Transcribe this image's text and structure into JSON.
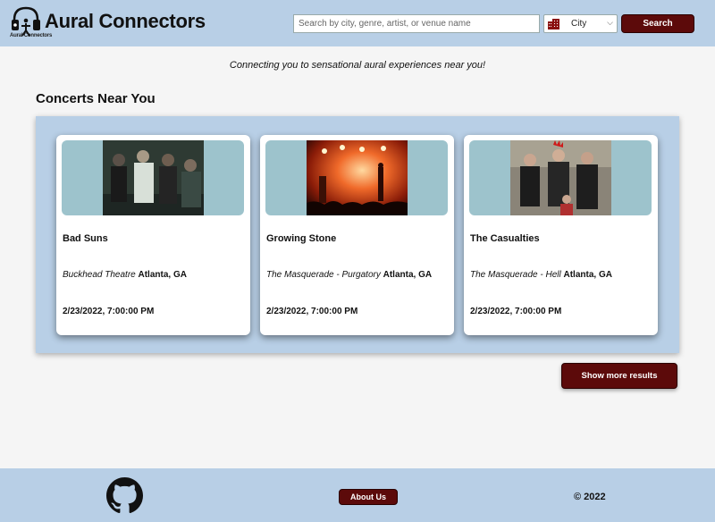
{
  "header": {
    "brand": "Aural Connectors",
    "logo_sub": "Aural Connectors",
    "search_placeholder": "Search by city, genre, artist, or venue name",
    "city_label": "City",
    "search_button": "Search"
  },
  "tagline": "Connecting you to sensational aural experiences near you!",
  "section_title": "Concerts Near You",
  "concerts": [
    {
      "title": "Bad Suns",
      "venue": "Buckhead Theatre",
      "city": "Atlanta, GA",
      "date": "2/23/2022, 7:00:00 PM"
    },
    {
      "title": "Growing Stone",
      "venue": "The Masquerade - Purgatory",
      "city": "Atlanta, GA",
      "date": "2/23/2022, 7:00:00 PM"
    },
    {
      "title": "The Casualties",
      "venue": "The Masquerade - Hell",
      "city": "Atlanta, GA",
      "date": "2/23/2022, 7:00:00 PM"
    }
  ],
  "more_button": "Show more results",
  "footer": {
    "about_button": "About Us",
    "copyright": "© 2022"
  },
  "colors": {
    "header_bg": "#b8cfe6",
    "button_bg": "#5c0a0a",
    "image_bg": "#9dc3cc"
  }
}
